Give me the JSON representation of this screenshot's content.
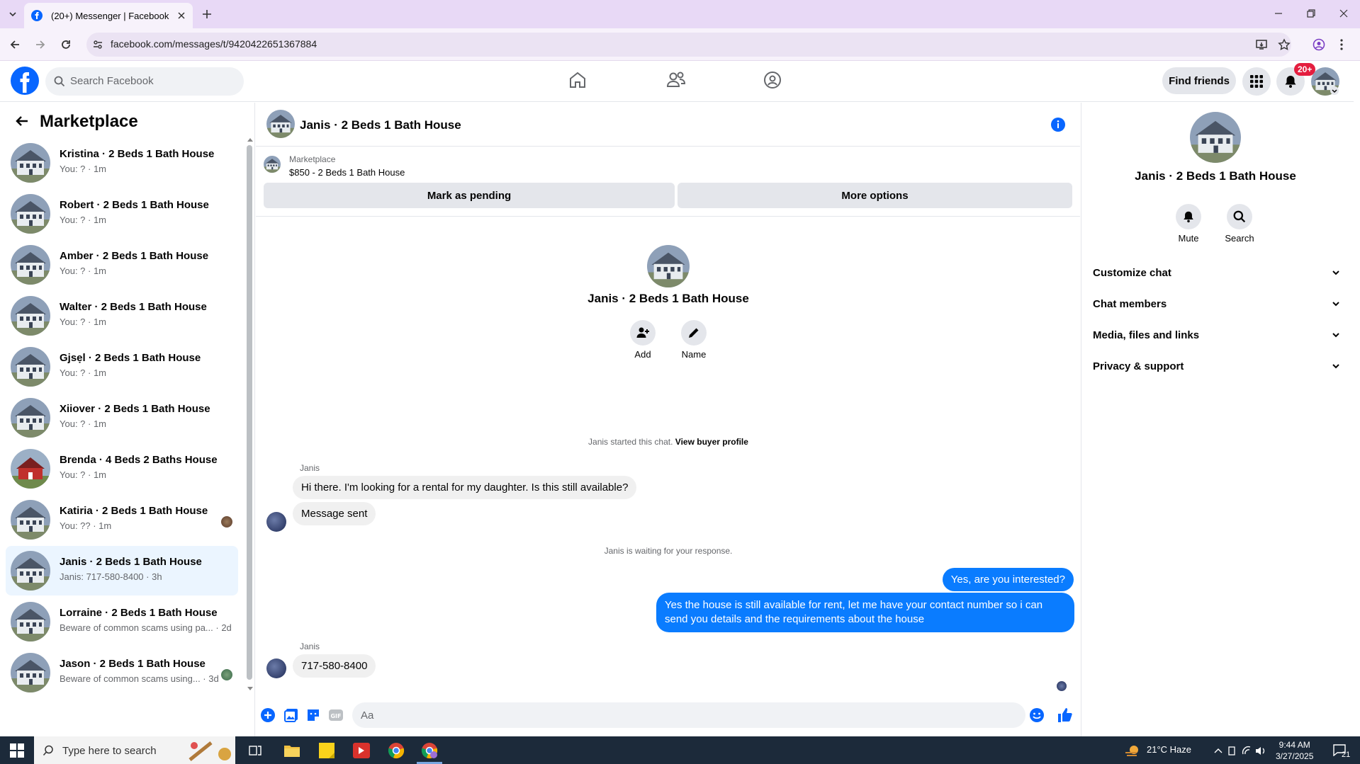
{
  "browser": {
    "tab_title": "(20+) Messenger | Facebook",
    "url": "facebook.com/messages/t/9420422651367884"
  },
  "header": {
    "search_placeholder": "Search Facebook",
    "find_friends": "Find friends",
    "notification_badge": "20+"
  },
  "left": {
    "title": "Marketplace",
    "conversations": [
      {
        "name": "Kristina · 2 Beds 1 Bath House",
        "sub": "You: ? · 1m",
        "thumb": "house-icon",
        "seen": false
      },
      {
        "name": "Robert · 2 Beds 1 Bath House",
        "sub": "You: ? · 1m",
        "thumb": "house-icon",
        "seen": false
      },
      {
        "name": "Amber · 2 Beds 1 Bath House",
        "sub": "You: ? · 1m",
        "thumb": "house-icon",
        "seen": false
      },
      {
        "name": "Walter · 2 Beds 1 Bath House",
        "sub": "You: ? · 1m",
        "thumb": "house-icon",
        "seen": false
      },
      {
        "name": "Gjsẹl · 2 Beds 1 Bath House",
        "sub": "You: ? · 1m",
        "thumb": "house-icon",
        "seen": false
      },
      {
        "name": "Xiiover · 2 Beds 1 Bath House",
        "sub": "You: ? · 1m",
        "thumb": "house-icon",
        "seen": false
      },
      {
        "name": "Brenda · 4 Beds 2 Baths House",
        "sub": "You: ? · 1m",
        "thumb": "red-house-icon",
        "seen": false
      },
      {
        "name": "Katiria · 2 Beds 1 Bath House",
        "sub": "You: ?? · 1m",
        "thumb": "house-icon",
        "seen": true
      },
      {
        "name": "Janis · 2 Beds 1 Bath House",
        "sub": "Janis: 717-580-8400 · 3h",
        "thumb": "house-icon",
        "seen": false,
        "active": true
      },
      {
        "name": "Lorraine · 2 Beds 1 Bath House",
        "sub": "Beware of common scams using pa... · 2d",
        "thumb": "house-icon",
        "seen": false
      },
      {
        "name": "Jason · 2 Beds 1 Bath House",
        "sub": "Beware of common scams using... · 3d",
        "thumb": "house-icon",
        "seen": true
      }
    ]
  },
  "chat": {
    "title": "Janis · 2 Beds 1 Bath House",
    "marketplace_label": "Marketplace",
    "listing": "$850 - 2 Beds 1 Bath House",
    "mark_pending": "Mark as pending",
    "more_options": "More options",
    "center_name": "Janis · 2 Beds 1 Bath House",
    "add_label": "Add",
    "name_label": "Name",
    "started_text": "Janis started this chat.",
    "view_buyer": "View buyer profile",
    "sender1": "Janis",
    "msg1": "Hi there. I'm looking for a rental for my daughter. Is this still available?",
    "msg2": "Message sent",
    "waiting": "Janis is waiting for your response.",
    "out1": "Yes, are you interested?",
    "out2": "Yes the house is still available for rent, let me have your contact number so i can send you details and the requirements about the house",
    "sender2": "Janis",
    "msg3": "717-580-8400",
    "composer_placeholder": "Aa"
  },
  "right": {
    "name": "Janis · 2 Beds 1 Bath House",
    "mute": "Mute",
    "search": "Search",
    "sections": [
      "Customize chat",
      "Chat members",
      "Media, files and links",
      "Privacy & support"
    ]
  },
  "taskbar": {
    "search_placeholder": "Type here to search",
    "weather": "21°C  Haze",
    "time": "9:44 AM",
    "date": "3/27/2025",
    "notif_count": "21"
  },
  "colors": {
    "accent": "#0866ff",
    "bubble_out": "#0a7cff",
    "badge": "#e41e3f"
  }
}
